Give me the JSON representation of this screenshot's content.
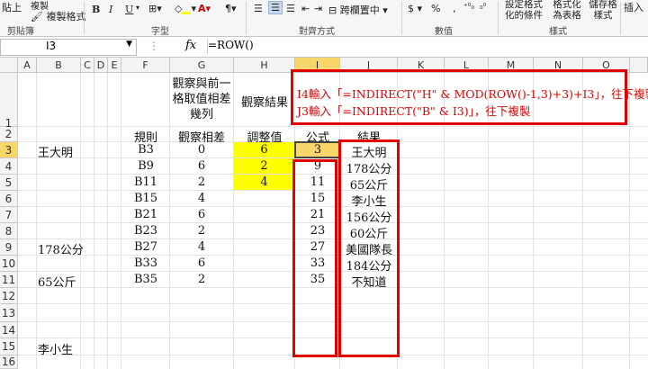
{
  "ribbon": {
    "paste": "貼上",
    "copy": "複製",
    "format_painter": "複製格式",
    "bold": "B",
    "italic": "I",
    "underline": "U",
    "font_color_letter": "A",
    "wrap_text": "自動換列",
    "merge_center": "跨欄置中",
    "currency": "$",
    "percent": "%",
    "comma": ",",
    "cond_format": "設定格式化的條件",
    "format_table": "格式化為表格",
    "cell_styles": "儲存格樣式",
    "insert": "插入",
    "groups": [
      "剪貼簿",
      "字型",
      "對齊方式",
      "數值",
      "樣式"
    ]
  },
  "formula_bar": {
    "name_box": "I3",
    "fx": "fx",
    "formula": "=ROW()"
  },
  "columns": [
    "A",
    "B",
    "C",
    "D",
    "E",
    "F",
    "G",
    "H",
    "I",
    "J",
    "K",
    "L",
    "M",
    "N",
    "O"
  ],
  "rows": [
    "1",
    "2",
    "3",
    "4",
    "5",
    "6",
    "7",
    "8",
    "9",
    "10",
    "11",
    "12",
    "13",
    "14",
    "15",
    "16"
  ],
  "headers": {
    "g1_line1": "觀察與前一",
    "g1_line2": "格取值相差",
    "g1_line3": "幾列",
    "h1": "觀察結果",
    "f2": "規則",
    "g2": "觀察相差",
    "h2": "調整值",
    "i2": "公式",
    "j2": "結果"
  },
  "col_b": {
    "b3": "王大明",
    "b9": "178公分",
    "b11": "65公斤",
    "b15": "李小生"
  },
  "col_f": [
    "B3",
    "B9",
    "B11",
    "B15",
    "B21",
    "B23",
    "B27",
    "B33",
    "B35"
  ],
  "col_g": [
    "0",
    "6",
    "2",
    "4",
    "6",
    "2",
    "4",
    "6",
    "2"
  ],
  "col_h": [
    "6",
    "2",
    "4"
  ],
  "col_i": [
    "3",
    "9",
    "11",
    "15",
    "21",
    "23",
    "27",
    "33",
    "35"
  ],
  "col_j": [
    "王大明",
    "178公分",
    "65公斤",
    "李小生",
    "156公分",
    "60公斤",
    "美國隊長",
    "184公分",
    "不知道"
  ],
  "notes": {
    "line1": "I4輸入「=INDIRECT(\"H\" & MOD(ROW()-1,3)+3)+I3」，往下複製",
    "line2": "J3輸入「=INDIRECT(\"B\" & I3)」，往下複製"
  },
  "colors": {
    "highlight": "#ffff00",
    "annotation": "#e00000",
    "selected_header": "#f8d66a"
  }
}
